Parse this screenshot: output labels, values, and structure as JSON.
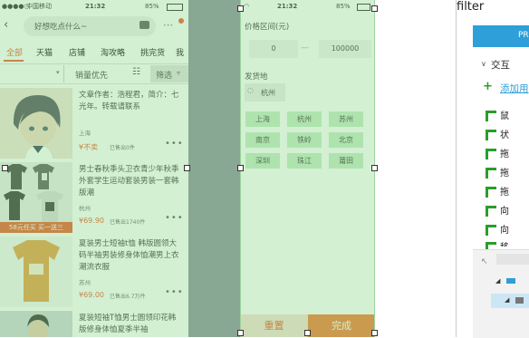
{
  "phone1": {
    "status": {
      "carrier": "中国移动",
      "time": "21:32",
      "battery": "85%"
    },
    "search_placeholder": "好想吃点什么~",
    "tabs": [
      "全部",
      "天猫",
      "店铺",
      "淘攻略",
      "挑完货",
      "我"
    ],
    "sort": {
      "sales_first": "销量优先",
      "filter": "筛选"
    },
    "items": [
      {
        "title": "文章作者：浩程君，简介：七光年。转载请联系",
        "location": "上海",
        "price": "¥不卖",
        "sold": "已售出0件"
      },
      {
        "title": "男士春秋季头卫衣青少年秋季外套学生运动套装男装一套韩版潮",
        "location": "杭州",
        "price": "¥69.90",
        "sold": "已售出1740件",
        "promo": "58元任买 买一送三"
      },
      {
        "title": "夏装男士短袖t恤 韩版圆领大码半袖男装修身体恤潮男上衣潮流衣服",
        "location": "苏州",
        "price": "¥69.00",
        "sold": "已售出6.7万件"
      },
      {
        "title": "夏装短袖T恤男士圆领印花韩版修身体恤夏季半袖"
      }
    ],
    "more": "•••"
  },
  "filter": {
    "status": {
      "time": "21:32",
      "battery": "85%"
    },
    "price_label": "价格区间(元)",
    "price_min": "0",
    "price_sep": "—",
    "price_max": "100000",
    "ship_label": "发货地",
    "current_city": "杭州",
    "cities": [
      "上海",
      "杭州",
      "苏州",
      "南京",
      "铁岭",
      "北京",
      "深圳",
      "珠江",
      "莆田"
    ],
    "reset": "重置",
    "done": "完成",
    "accent": "#f0742a"
  },
  "ide": {
    "title": "filter",
    "tab": "PR",
    "section": "交互",
    "add_label": "添加用",
    "rows": [
      "鼠",
      "状",
      "拖",
      "拖",
      "拖",
      "向",
      "向",
      "移"
    ],
    "accent": "#2e9fd8"
  }
}
